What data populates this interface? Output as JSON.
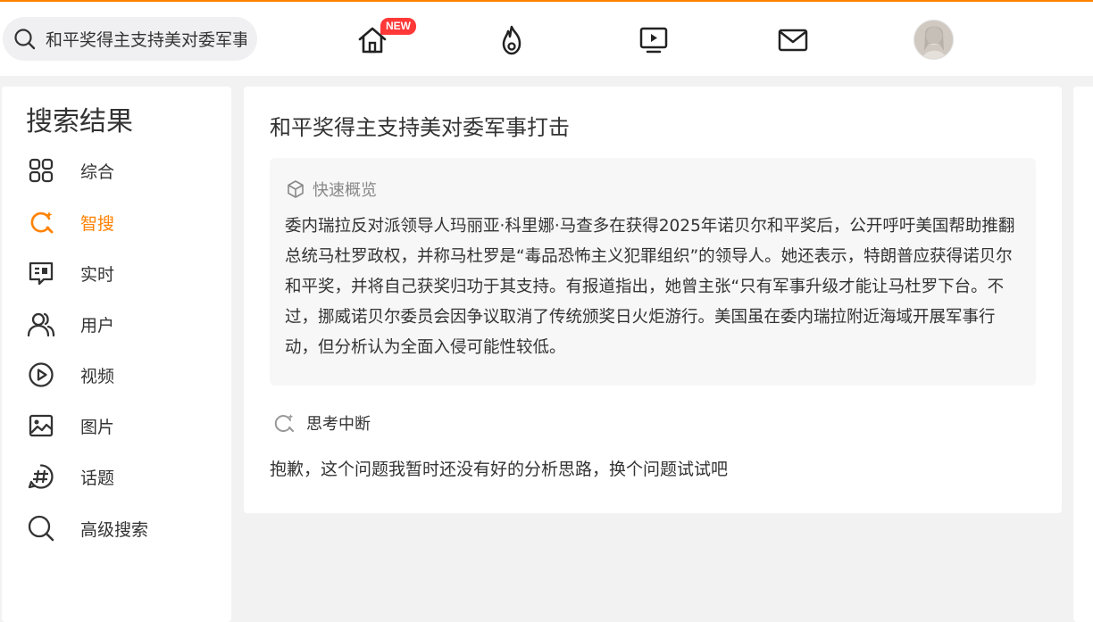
{
  "header": {
    "search": {
      "value": "和平奖得主支持美对委军事打击",
      "placeholder": ""
    },
    "nav": {
      "home_badge": "NEW",
      "icons": [
        "home-icon",
        "fire-icon",
        "video-icon",
        "mail-icon"
      ]
    },
    "accent_color": "#ff8200"
  },
  "sidebar": {
    "title": "搜索结果",
    "items": [
      {
        "label": "综合",
        "icon": "grid-icon"
      },
      {
        "label": "智搜",
        "icon": "smart-search-icon",
        "active": true
      },
      {
        "label": "实时",
        "icon": "realtime-icon"
      },
      {
        "label": "用户",
        "icon": "users-icon"
      },
      {
        "label": "视频",
        "icon": "play-icon"
      },
      {
        "label": "图片",
        "icon": "image-icon"
      },
      {
        "label": "话题",
        "icon": "hashtag-icon"
      },
      {
        "label": "高级搜索",
        "icon": "search-icon"
      }
    ]
  },
  "main": {
    "title": "和平奖得主支持美对委军事打击",
    "overview": {
      "heading": "快速概览",
      "text": "委内瑞拉反对派领导人玛丽亚·科里娜·马查多在获得2025年诺贝尔和平奖后，公开呼吁美国帮助推翻总统马杜罗政权，并称马杜罗是“毒品恐怖主义犯罪组织”的领导人。她还表示，特朗普应获得诺贝尔和平奖，并将自己获奖归功于其支持。有报道指出，她曾主张“只有军事升级才能让马杜罗下台。不过，挪威诺贝尔委员会因争议取消了传统颁奖日火炬游行。美国虽在委内瑞拉附近海域开展军事行动，但分析认为全面入侵可能性较低。"
    },
    "thinking_status": "思考中断",
    "answer": "抱歉，这个问题我暂时还没有好的分析思路，换个问题试试吧"
  }
}
